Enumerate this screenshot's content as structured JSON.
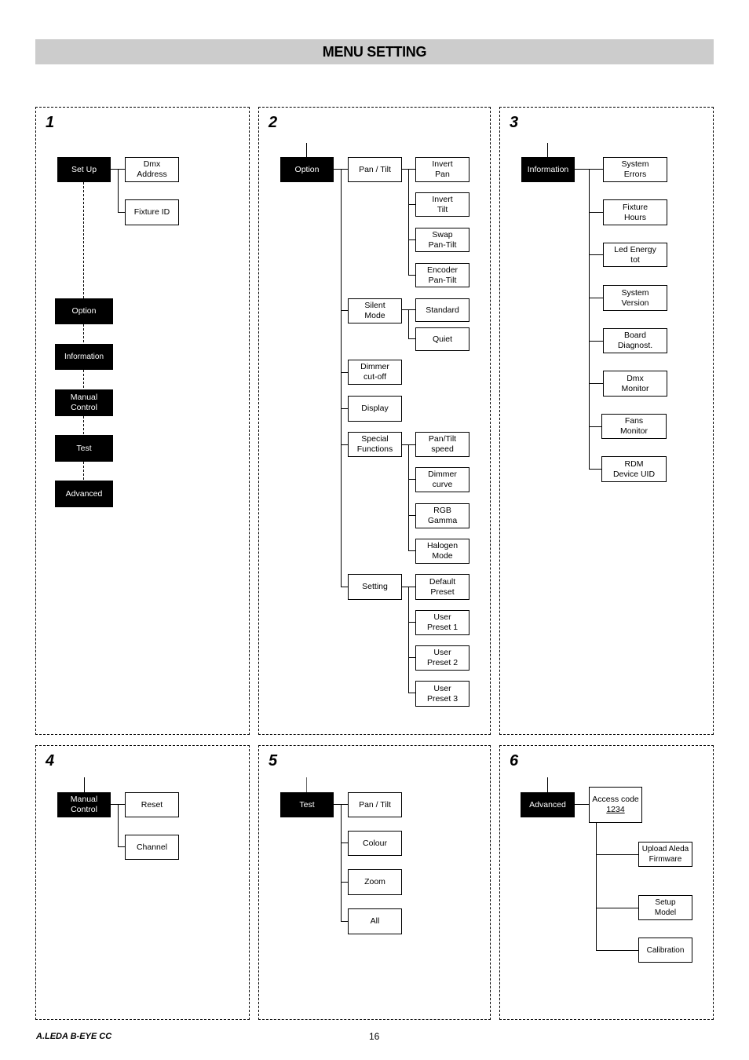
{
  "header": {
    "title": "MENU SETTING"
  },
  "panels": [
    {
      "number": "1",
      "root": "Set Up",
      "children": [
        "Dmx\nAddress",
        "Fixture ID"
      ],
      "main_menu": [
        "Option",
        "Information",
        "Manual\nControl",
        "Test",
        "Advanced"
      ]
    },
    {
      "number": "2",
      "root": "Option",
      "groups": [
        {
          "label": "Pan / Tilt",
          "items": [
            "Invert\nPan",
            "Invert\nTilt",
            "Swap\nPan-Tilt",
            "Encoder\nPan-Tilt"
          ]
        },
        {
          "label": "Silent\nMode",
          "items": [
            "Standard",
            "Quiet"
          ]
        },
        {
          "label": "Dimmer\ncut-off",
          "items": []
        },
        {
          "label": "Display",
          "items": []
        },
        {
          "label": "Special\nFunctions",
          "items": [
            "Pan/Tilt\nspeed",
            "Dimmer\ncurve",
            "RGB\nGamma",
            "Halogen\nMode"
          ]
        },
        {
          "label": "Setting",
          "items": [
            "Default\nPreset",
            "User\nPreset 1",
            "User\nPreset 2",
            "User\nPreset 3"
          ]
        }
      ]
    },
    {
      "number": "3",
      "root": "Information",
      "children": [
        "System\nErrors",
        "Fixture\nHours",
        "Led Energy\ntot",
        "System\nVersion",
        "Board\nDiagnost.",
        "Dmx\nMonitor",
        "Fans\nMonitor",
        "RDM\nDevice UID"
      ]
    },
    {
      "number": "4",
      "root": "Manual\nControl",
      "children": [
        "Reset",
        "Channel"
      ]
    },
    {
      "number": "5",
      "root": "Test",
      "children": [
        "Pan / Tilt",
        "Colour",
        "Zoom",
        "All"
      ]
    },
    {
      "number": "6",
      "root": "Advanced",
      "access": {
        "label": "Access code",
        "code": "1234"
      },
      "children": [
        "Upload Aleda\nFirmware",
        "Setup\nModel",
        "Calibration"
      ]
    }
  ],
  "footer": {
    "product": "A.LEDA B-EYE CC",
    "page": "16"
  }
}
